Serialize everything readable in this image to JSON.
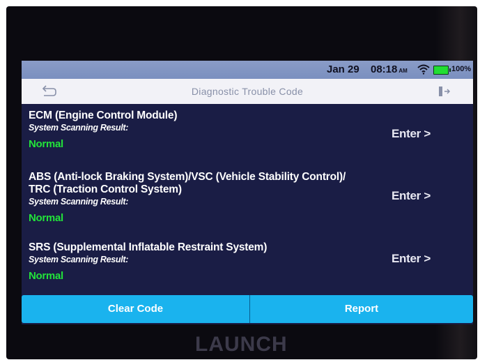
{
  "status_bar": {
    "date": "Jan 29",
    "time": "08:18",
    "ampm": "AM",
    "battery": "100%",
    "battery_color": "#22dd33"
  },
  "header": {
    "back_icon": "back-arrow-icon",
    "title": "Diagnostic Trouble Code",
    "exit_icon": "exit-icon"
  },
  "systems": [
    {
      "name_lines": [
        "ECM (Engine Control Module)"
      ],
      "label": "System Scanning Result:",
      "result": "Normal",
      "enter": "Enter >"
    },
    {
      "name_lines": [
        "ABS (Anti-lock Braking System)/VSC (Vehicle Stability Control)/",
        "TRC (Traction Control System)"
      ],
      "label": "System Scanning Result:",
      "result": "Normal",
      "enter": "Enter >"
    },
    {
      "name_lines": [
        "SRS (Supplemental Inflatable Restraint System)"
      ],
      "label": "System Scanning Result:",
      "result": "Normal",
      "enter": "Enter >"
    }
  ],
  "footer": {
    "clear_code": "Clear Code",
    "report": "Report",
    "accent_color": "#1ab3ee"
  },
  "device_brand": "LAUNCH",
  "colors": {
    "screen_bg": "#1a1d45",
    "normal_status": "#22e33a"
  }
}
